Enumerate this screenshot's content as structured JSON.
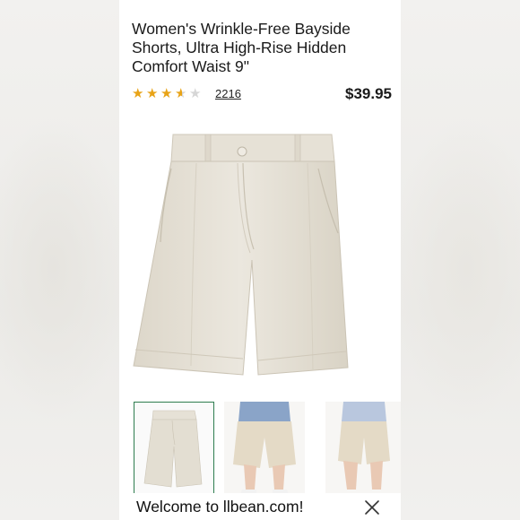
{
  "product": {
    "title": "Women's Wrinkle-Free Bayside Shorts, Ultra High-Rise Hidden Comfort Waist 9\"",
    "rating": 3.5,
    "rating_max": 5,
    "review_count": "2216",
    "price": "$39.95"
  },
  "images": {
    "hero_alt": "khaki-shorts-flat",
    "thumbnails": [
      {
        "name": "shorts-flat",
        "selected": true
      },
      {
        "name": "model-front",
        "selected": false
      },
      {
        "name": "model-back",
        "selected": false
      }
    ]
  },
  "banner": {
    "welcome_text": "Welcome to llbean.com!",
    "close_icon": "close-icon"
  },
  "colors": {
    "star_filled": "#e8a317",
    "star_empty": "#d6d6d6",
    "selected_outline": "#2e7d4f",
    "shorts_fabric": "#e7e2d7"
  }
}
